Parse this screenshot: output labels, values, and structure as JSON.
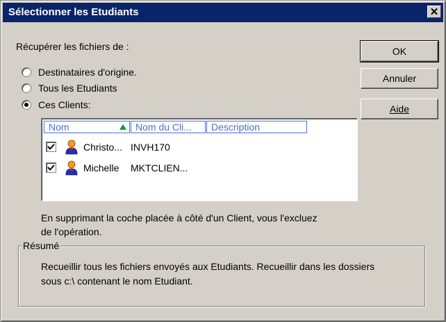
{
  "window": {
    "title": "Sélectionner les Etudiants"
  },
  "prompt_label": "Récupérer les fichiers de :",
  "buttons": {
    "ok": "OK",
    "cancel": "Annuler",
    "help": "Aide"
  },
  "radios": [
    {
      "label": "Destinataires d'origine.",
      "checked": false
    },
    {
      "label": "Tous les Etudiants",
      "checked": false
    },
    {
      "label": "Ces Clients:",
      "checked": true
    }
  ],
  "list": {
    "columns": [
      "Nom",
      "Nom du Cli...",
      "Description"
    ],
    "sort_column": "Nom",
    "rows": [
      {
        "name": "Christo...",
        "client": "INVH170",
        "description": "",
        "checked": true
      },
      {
        "name": "Michelle",
        "client": "MKTCLIEN...",
        "description": "",
        "checked": true
      }
    ]
  },
  "hint": {
    "line1": "En supprimant la coche placée à côté d'un Client, vous l'excluez",
    "line2": "de l'opération."
  },
  "summary": {
    "legend": "Résumé",
    "line1": "Recueillir tous les fichiers envoyés aux Etudiants. Recueillir dans les dossiers",
    "line2": "sous c:\\ contenant le nom Etudiant."
  },
  "colors": {
    "titlebar": "#0a246a",
    "face": "#d4d0c8",
    "header_text": "#4a6fd0",
    "sort_arrow": "#1a9a1a"
  },
  "icons": {
    "row_icon": "user-icon",
    "close": "close-icon",
    "sort": "sort-ascending-icon"
  }
}
